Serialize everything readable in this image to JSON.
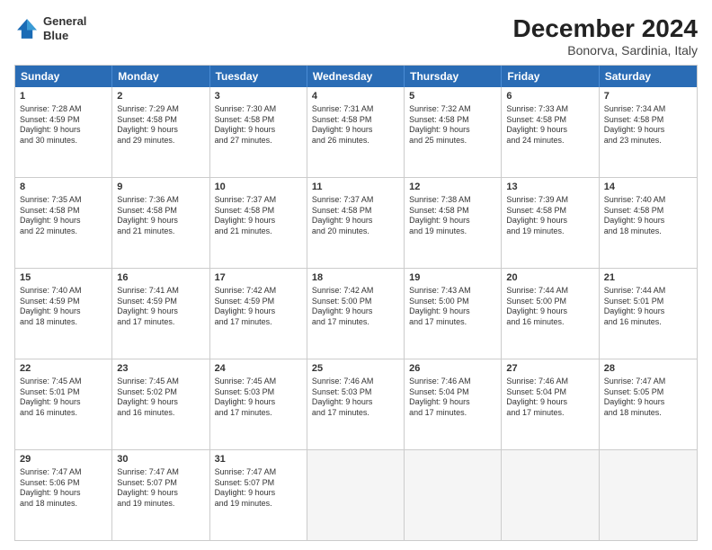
{
  "header": {
    "logo_line1": "General",
    "logo_line2": "Blue",
    "month": "December 2024",
    "location": "Bonorva, Sardinia, Italy"
  },
  "weekdays": [
    "Sunday",
    "Monday",
    "Tuesday",
    "Wednesday",
    "Thursday",
    "Friday",
    "Saturday"
  ],
  "rows": [
    [
      {
        "day": "1",
        "lines": [
          "Sunrise: 7:28 AM",
          "Sunset: 4:59 PM",
          "Daylight: 9 hours",
          "and 30 minutes."
        ]
      },
      {
        "day": "2",
        "lines": [
          "Sunrise: 7:29 AM",
          "Sunset: 4:58 PM",
          "Daylight: 9 hours",
          "and 29 minutes."
        ]
      },
      {
        "day": "3",
        "lines": [
          "Sunrise: 7:30 AM",
          "Sunset: 4:58 PM",
          "Daylight: 9 hours",
          "and 27 minutes."
        ]
      },
      {
        "day": "4",
        "lines": [
          "Sunrise: 7:31 AM",
          "Sunset: 4:58 PM",
          "Daylight: 9 hours",
          "and 26 minutes."
        ]
      },
      {
        "day": "5",
        "lines": [
          "Sunrise: 7:32 AM",
          "Sunset: 4:58 PM",
          "Daylight: 9 hours",
          "and 25 minutes."
        ]
      },
      {
        "day": "6",
        "lines": [
          "Sunrise: 7:33 AM",
          "Sunset: 4:58 PM",
          "Daylight: 9 hours",
          "and 24 minutes."
        ]
      },
      {
        "day": "7",
        "lines": [
          "Sunrise: 7:34 AM",
          "Sunset: 4:58 PM",
          "Daylight: 9 hours",
          "and 23 minutes."
        ]
      }
    ],
    [
      {
        "day": "8",
        "lines": [
          "Sunrise: 7:35 AM",
          "Sunset: 4:58 PM",
          "Daylight: 9 hours",
          "and 22 minutes."
        ]
      },
      {
        "day": "9",
        "lines": [
          "Sunrise: 7:36 AM",
          "Sunset: 4:58 PM",
          "Daylight: 9 hours",
          "and 21 minutes."
        ]
      },
      {
        "day": "10",
        "lines": [
          "Sunrise: 7:37 AM",
          "Sunset: 4:58 PM",
          "Daylight: 9 hours",
          "and 21 minutes."
        ]
      },
      {
        "day": "11",
        "lines": [
          "Sunrise: 7:37 AM",
          "Sunset: 4:58 PM",
          "Daylight: 9 hours",
          "and 20 minutes."
        ]
      },
      {
        "day": "12",
        "lines": [
          "Sunrise: 7:38 AM",
          "Sunset: 4:58 PM",
          "Daylight: 9 hours",
          "and 19 minutes."
        ]
      },
      {
        "day": "13",
        "lines": [
          "Sunrise: 7:39 AM",
          "Sunset: 4:58 PM",
          "Daylight: 9 hours",
          "and 19 minutes."
        ]
      },
      {
        "day": "14",
        "lines": [
          "Sunrise: 7:40 AM",
          "Sunset: 4:58 PM",
          "Daylight: 9 hours",
          "and 18 minutes."
        ]
      }
    ],
    [
      {
        "day": "15",
        "lines": [
          "Sunrise: 7:40 AM",
          "Sunset: 4:59 PM",
          "Daylight: 9 hours",
          "and 18 minutes."
        ]
      },
      {
        "day": "16",
        "lines": [
          "Sunrise: 7:41 AM",
          "Sunset: 4:59 PM",
          "Daylight: 9 hours",
          "and 17 minutes."
        ]
      },
      {
        "day": "17",
        "lines": [
          "Sunrise: 7:42 AM",
          "Sunset: 4:59 PM",
          "Daylight: 9 hours",
          "and 17 minutes."
        ]
      },
      {
        "day": "18",
        "lines": [
          "Sunrise: 7:42 AM",
          "Sunset: 5:00 PM",
          "Daylight: 9 hours",
          "and 17 minutes."
        ]
      },
      {
        "day": "19",
        "lines": [
          "Sunrise: 7:43 AM",
          "Sunset: 5:00 PM",
          "Daylight: 9 hours",
          "and 17 minutes."
        ]
      },
      {
        "day": "20",
        "lines": [
          "Sunrise: 7:44 AM",
          "Sunset: 5:00 PM",
          "Daylight: 9 hours",
          "and 16 minutes."
        ]
      },
      {
        "day": "21",
        "lines": [
          "Sunrise: 7:44 AM",
          "Sunset: 5:01 PM",
          "Daylight: 9 hours",
          "and 16 minutes."
        ]
      }
    ],
    [
      {
        "day": "22",
        "lines": [
          "Sunrise: 7:45 AM",
          "Sunset: 5:01 PM",
          "Daylight: 9 hours",
          "and 16 minutes."
        ]
      },
      {
        "day": "23",
        "lines": [
          "Sunrise: 7:45 AM",
          "Sunset: 5:02 PM",
          "Daylight: 9 hours",
          "and 16 minutes."
        ]
      },
      {
        "day": "24",
        "lines": [
          "Sunrise: 7:45 AM",
          "Sunset: 5:03 PM",
          "Daylight: 9 hours",
          "and 17 minutes."
        ]
      },
      {
        "day": "25",
        "lines": [
          "Sunrise: 7:46 AM",
          "Sunset: 5:03 PM",
          "Daylight: 9 hours",
          "and 17 minutes."
        ]
      },
      {
        "day": "26",
        "lines": [
          "Sunrise: 7:46 AM",
          "Sunset: 5:04 PM",
          "Daylight: 9 hours",
          "and 17 minutes."
        ]
      },
      {
        "day": "27",
        "lines": [
          "Sunrise: 7:46 AM",
          "Sunset: 5:04 PM",
          "Daylight: 9 hours",
          "and 17 minutes."
        ]
      },
      {
        "day": "28",
        "lines": [
          "Sunrise: 7:47 AM",
          "Sunset: 5:05 PM",
          "Daylight: 9 hours",
          "and 18 minutes."
        ]
      }
    ],
    [
      {
        "day": "29",
        "lines": [
          "Sunrise: 7:47 AM",
          "Sunset: 5:06 PM",
          "Daylight: 9 hours",
          "and 18 minutes."
        ]
      },
      {
        "day": "30",
        "lines": [
          "Sunrise: 7:47 AM",
          "Sunset: 5:07 PM",
          "Daylight: 9 hours",
          "and 19 minutes."
        ]
      },
      {
        "day": "31",
        "lines": [
          "Sunrise: 7:47 AM",
          "Sunset: 5:07 PM",
          "Daylight: 9 hours",
          "and 19 minutes."
        ]
      },
      null,
      null,
      null,
      null
    ]
  ]
}
